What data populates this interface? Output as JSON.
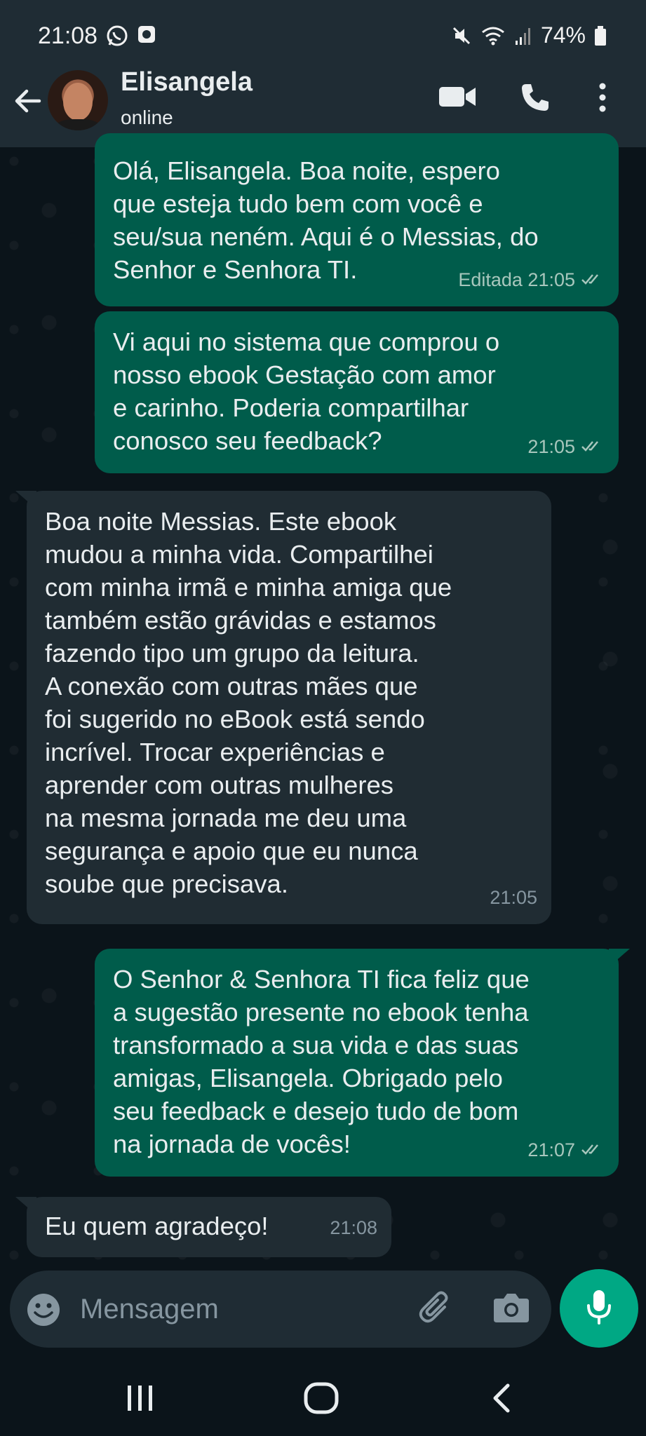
{
  "status_bar": {
    "time": "21:08",
    "battery": "74%",
    "left_icons": [
      "whatsapp-icon",
      "notification-app-icon"
    ],
    "right_icons": [
      "mute-icon",
      "wifi-icon",
      "signal-icon",
      "battery-icon"
    ]
  },
  "header": {
    "contact_name": "Elisangela",
    "contact_status": "online",
    "icons": [
      "back-arrow-icon",
      "video-call-icon",
      "phone-icon",
      "more-vertical-icon"
    ]
  },
  "messages": [
    {
      "direction": "outgoing",
      "text": "Olá, Elisangela. Boa noite, espero\nque esteja tudo bem com você e\nseu/sua neném. Aqui é o Messias, do\nSenhor e Senhora TI.",
      "meta": "Editada 21:05",
      "read": true
    },
    {
      "direction": "outgoing",
      "text": "Vi aqui no sistema que comprou o\nnosso ebook Gestação com amor\ne carinho. Poderia compartilhar\nconosco seu feedback?",
      "meta": "21:05",
      "read": true
    },
    {
      "direction": "incoming",
      "text": "Boa noite Messias. Este ebook\nmudou a minha vida. Compartilhei\ncom minha irmã e minha amiga que\ntambém estão grávidas e estamos\nfazendo tipo um grupo da leitura.\nA conexão com outras mães que\nfoi sugerido no eBook está sendo\nincrível. Trocar experiências e\naprender com outras mulheres\nna mesma jornada me deu uma\nsegurança e apoio que eu nunca\nsoube que precisava.",
      "meta": "21:05"
    },
    {
      "direction": "outgoing",
      "text": "O Senhor & Senhora TI fica feliz que\na sugestão presente no ebook tenha\ntransformado a sua vida e das suas\namigas, Elisangela. Obrigado pelo\nseu feedback e desejo tudo de bom\nna jornada de vocês!",
      "meta": "21:07",
      "read": true
    },
    {
      "direction": "incoming",
      "text": "Eu quem agradeço!",
      "meta": "21:08"
    }
  ],
  "input": {
    "placeholder": "Mensagem",
    "icons": [
      "emoji-icon",
      "attach-icon",
      "camera-icon",
      "mic-icon"
    ]
  },
  "colors": {
    "outgoing_bubble": "#005c4b",
    "incoming_bubble": "#202c33",
    "accent": "#00a884",
    "background": "#0b141a",
    "bar": "#1f2c34"
  }
}
